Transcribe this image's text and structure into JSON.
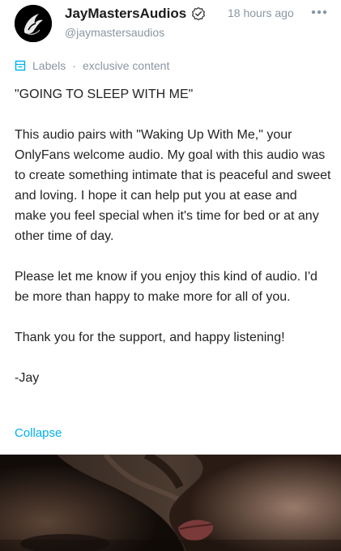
{
  "post": {
    "author": {
      "display_name": "JayMastersAudios",
      "handle": "@jaymastersaudios",
      "verified": true
    },
    "timestamp": "18 hours ago",
    "labels": {
      "label": "Labels",
      "separator": "·",
      "value": "exclusive content"
    },
    "body": [
      "\"GOING TO SLEEP WITH ME\"",
      "This audio pairs with \"Waking Up With Me,\" your OnlyFans welcome audio. My goal with this audio was to create something intimate that is peaceful and sweet and loving. I hope it can help put you at ease and make you feel special when it's time for bed or at any other time of day.",
      "Please let me know if you enjoy this kind of audio. I'd be more than happy to make more for all of you.",
      "Thank you for the support, and happy listening!",
      "-Jay"
    ],
    "collapse_label": "Collapse"
  },
  "icons": {
    "avatar": "avatar-logo",
    "verified": "verified-badge-icon",
    "more": "more-options-icon",
    "labels": "labels-icon"
  },
  "colors": {
    "accent": "#00aff0",
    "muted": "#8a96a3",
    "text": "#242424"
  }
}
